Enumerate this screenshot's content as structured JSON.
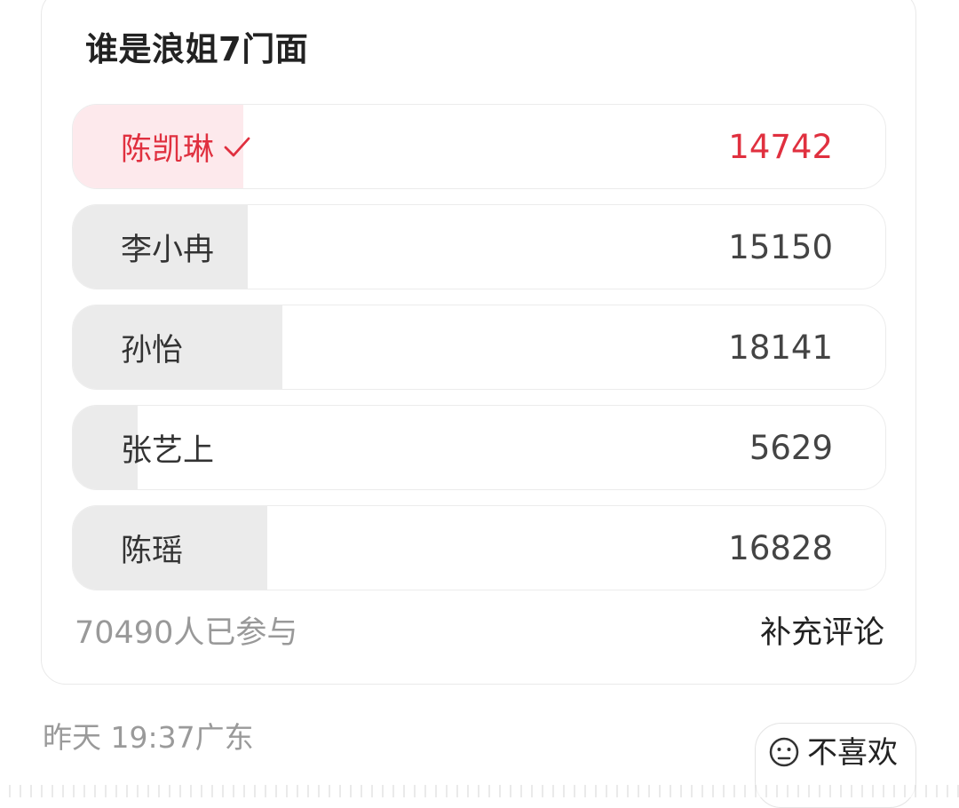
{
  "poll": {
    "title": "谁是浪姐7门面",
    "options": [
      {
        "label": "陈凯琳",
        "count": "14742",
        "selected": true,
        "share": 0.2091
      },
      {
        "label": "李小冉",
        "count": "15150",
        "selected": false,
        "share": 0.2149
      },
      {
        "label": "孙怡",
        "count": "18141",
        "selected": false,
        "share": 0.2574
      },
      {
        "label": "张艺上",
        "count": "5629",
        "selected": false,
        "share": 0.0799
      },
      {
        "label": "陈瑶",
        "count": "16828",
        "selected": false,
        "share": 0.2387
      }
    ],
    "participants": "70490人已参与",
    "add_comment": "补充评论",
    "selected_icon": "check-icon",
    "colors": {
      "selected": "#e0303f",
      "selected_fill": "#fde9ec",
      "fill": "#ebebeb"
    }
  },
  "meta": {
    "post_time": "昨天 19:37广东",
    "dislike_label": "不喜欢",
    "dislike_icon": "confused-face-icon"
  }
}
